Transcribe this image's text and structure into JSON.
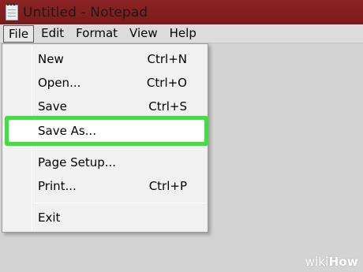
{
  "window": {
    "title": "Untitled - Notepad",
    "icon": "notepad-icon"
  },
  "menubar": {
    "items": [
      {
        "label": "File",
        "name": "file"
      },
      {
        "label": "Edit",
        "name": "edit"
      },
      {
        "label": "Format",
        "name": "format"
      },
      {
        "label": "View",
        "name": "view"
      },
      {
        "label": "Help",
        "name": "help"
      }
    ]
  },
  "file_menu": {
    "items": [
      {
        "label": "New",
        "shortcut": "Ctrl+N"
      },
      {
        "label": "Open...",
        "shortcut": "Ctrl+O"
      },
      {
        "label": "Save",
        "shortcut": "Ctrl+S"
      },
      {
        "label": "Save As...",
        "shortcut": ""
      },
      {
        "label": "Page Setup...",
        "shortcut": ""
      },
      {
        "label": "Print...",
        "shortcut": "Ctrl+P"
      },
      {
        "label": "Exit",
        "shortcut": ""
      }
    ],
    "highlighted": "Save As..."
  },
  "colors": {
    "titlebar": "#8c2424",
    "highlight_border": "#3de23d",
    "menu_background": "#f1f1f1"
  },
  "watermark": {
    "part1": "wiki",
    "part2": "How"
  }
}
